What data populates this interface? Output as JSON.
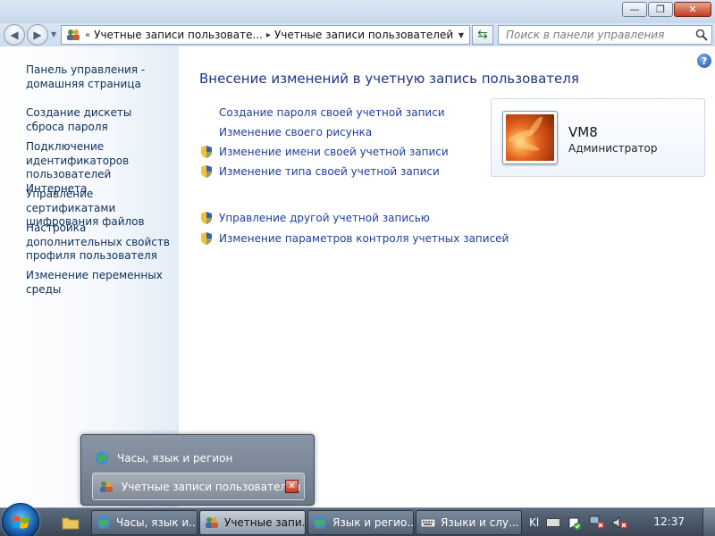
{
  "window": {
    "caption_buttons": {
      "minimize": "—",
      "maximize": "❐",
      "close": "✕"
    }
  },
  "nav": {
    "address": {
      "overflow": "«",
      "crumbs": [
        "Учетные записи пользовате...",
        "Учетные записи пользователей"
      ],
      "separator": "▸"
    },
    "search_placeholder": "Поиск в панели управления"
  },
  "sidebar": {
    "items": [
      {
        "label": "Панель управления - домашняя страница"
      },
      {
        "label": "Создание дискеты сброса пароля"
      },
      {
        "label": "Подключение идентификаторов пользователей Интернета"
      },
      {
        "label": "Управление сертификатами шифрования файлов"
      },
      {
        "label": "Настройка дополнительных свойств профиля пользователя"
      },
      {
        "label": "Изменение переменных среды"
      }
    ]
  },
  "main": {
    "help": "?",
    "title": "Внесение изменений в учетную запись пользователя",
    "tasks": [
      {
        "label": "Создание пароля своей учетной записи",
        "shield": false
      },
      {
        "label": "Изменение своего рисунка",
        "shield": false
      },
      {
        "label": "Изменение имени своей учетной записи",
        "shield": true
      },
      {
        "label": "Изменение типа своей учетной записи",
        "shield": true
      }
    ],
    "other_tasks": [
      {
        "label": "Управление другой учетной записью",
        "shield": true
      },
      {
        "label": "Изменение параметров контроля учетных записей",
        "shield": true
      }
    ],
    "user": {
      "name": "VM8",
      "role": "Администратор"
    }
  },
  "thumbnail_popup": {
    "items": [
      {
        "label": "Часы, язык и регион"
      },
      {
        "label": "Учетные записи пользователей"
      }
    ]
  },
  "taskbar": {
    "buttons": [
      {
        "label": "Часы, язык и..."
      },
      {
        "label": "Учетные запи..."
      },
      {
        "label": "Язык и регио..."
      },
      {
        "label": "Языки и слу..."
      }
    ],
    "tray": {
      "language": "Kl"
    },
    "clock": "12:37"
  },
  "colors": {
    "link": "#1e3f9b",
    "title": "#1e3287",
    "sidebar_link": "#0b2f5a",
    "taskbar": "#3a4656"
  }
}
